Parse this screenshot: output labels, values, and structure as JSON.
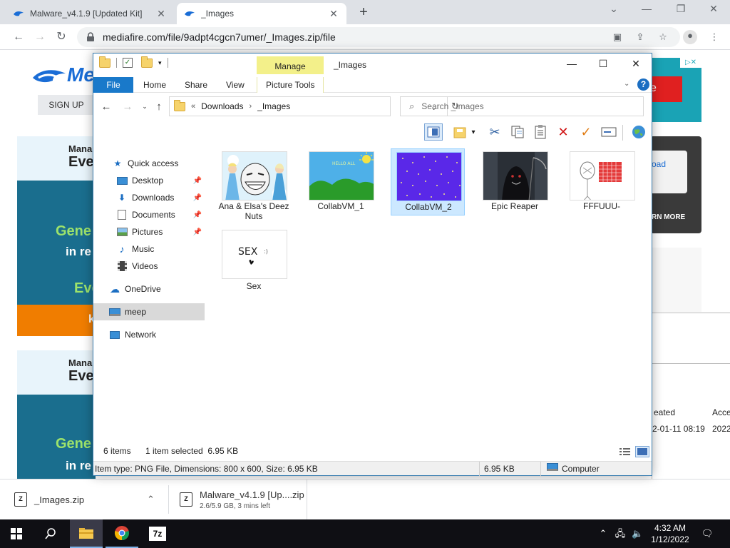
{
  "browser": {
    "tabs": [
      {
        "title": "Malware_v4.1.9 [Updated Kit]",
        "active": false
      },
      {
        "title": "_Images",
        "active": true
      }
    ],
    "url": "mediafire.com/file/9adpt4cgcn7umer/_Images.zip/file"
  },
  "mediafire": {
    "logo_text": "Me",
    "signup_label": "SIGN UP",
    "card1": {
      "line1": "Mana",
      "line2": "Eve",
      "green": "Gene",
      "white": "in re",
      "green2": "Eve",
      "orange_text": "k"
    },
    "card2": {
      "line1": "Mana",
      "line2": "Eve",
      "green": "Gene",
      "white": "in re"
    },
    "ad_close": "▷✕",
    "ad_letter": "e",
    "dark_box_link": "oad",
    "dark_box_learn": "RN MORE",
    "panel": {
      "header_created": "eated",
      "header_accessed": "Acce",
      "value_created": "2-01-11 08:19",
      "value_accessed": "2022-"
    }
  },
  "downloads": [
    {
      "name": "_Images.zip",
      "sub": ""
    },
    {
      "name": "Malware_v4.1.9 [Up....zip",
      "sub": "2.6/5.9 GB, 3 mins left"
    }
  ],
  "taskbar": {
    "time": "4:32 AM",
    "date": "1/12/2022"
  },
  "explorer": {
    "title": "_Images",
    "manage_label": "Manage",
    "ribbon_tabs": [
      "File",
      "Home",
      "Share",
      "View",
      "Picture Tools"
    ],
    "breadcrumb": [
      "Downloads",
      "_Images"
    ],
    "search_placeholder": "Search _Images",
    "nav": [
      {
        "label": "Quick access",
        "icon": "star-icon",
        "pinned": false
      },
      {
        "label": "Desktop",
        "icon": "desktop-icon",
        "pinned": true
      },
      {
        "label": "Downloads",
        "icon": "download-icon",
        "pinned": true
      },
      {
        "label": "Documents",
        "icon": "documents-icon",
        "pinned": true
      },
      {
        "label": "Pictures",
        "icon": "pictures-icon",
        "pinned": true
      },
      {
        "label": "Music",
        "icon": "music-icon",
        "pinned": false
      },
      {
        "label": "Videos",
        "icon": "videos-icon",
        "pinned": false
      },
      {
        "label": "OneDrive",
        "icon": "cloud-icon",
        "pinned": false
      },
      {
        "label": "meep",
        "icon": "computer-icon",
        "pinned": false
      },
      {
        "label": "Network",
        "icon": "network-icon",
        "pinned": false
      }
    ],
    "files": [
      {
        "name": "Ana & Elsa's Deez Nuts",
        "selected": false
      },
      {
        "name": "CollabVM_1",
        "selected": false
      },
      {
        "name": "CollabVM_2",
        "selected": true
      },
      {
        "name": "Epic Reaper",
        "selected": false
      },
      {
        "name": "FFFUUU-",
        "selected": false
      },
      {
        "name": "Sex",
        "selected": false
      }
    ],
    "thumb_text": {
      "collab1": "HELLO ALL",
      "sex": "SEX"
    },
    "status": {
      "count": "6 items",
      "selection": "1 item selected  6.95 KB"
    },
    "details": {
      "info": "Item type: PNG File, Dimensions: 800 x 600, Size: 6.95 KB",
      "size": "6.95 KB",
      "location": "Computer"
    }
  }
}
